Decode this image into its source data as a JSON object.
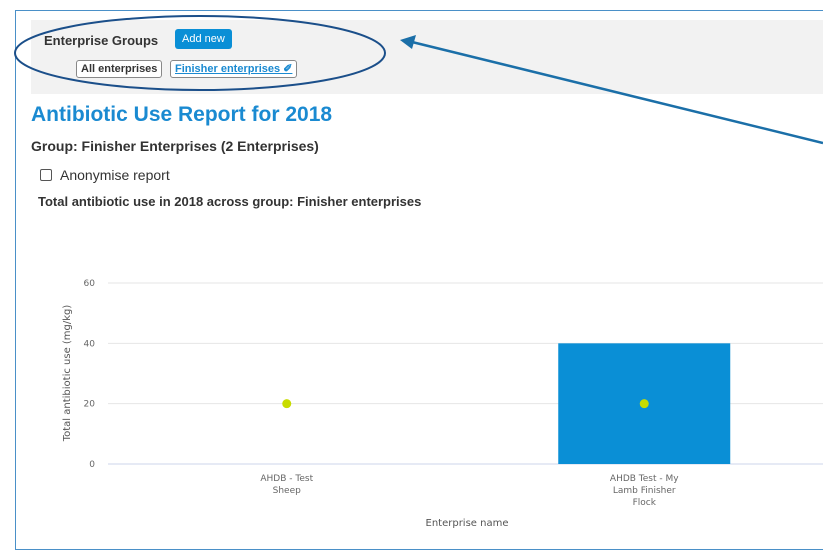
{
  "groups": {
    "title": "Enterprise Groups",
    "add_label": "Add new",
    "chips": [
      "All enterprises",
      "Finisher enterprises ✐"
    ]
  },
  "report": {
    "title": "Antibiotic Use Report for 2018",
    "group": "Group: Finisher Enterprises (2 Enterprises)",
    "anonymise_label": "Anonymise report",
    "chart_caption": "Total antibiotic use in 2018 across group: Finisher enterprises"
  },
  "colors": {
    "accent": "#1a8ad1",
    "bar": "#0a8fd6",
    "marker": "#c8dc00"
  },
  "chart_data": {
    "type": "bar",
    "categories": [
      "AHDB - Test Sheep",
      "AHDB Test - My Lamb Finisher Flock"
    ],
    "category_lines": [
      [
        "AHDB - Test",
        "Sheep"
      ],
      [
        "AHDB Test - My",
        "Lamb Finisher",
        "Flock"
      ]
    ],
    "values": [
      0,
      40
    ],
    "markers": [
      20,
      20
    ],
    "xlabel": "Enterprise name",
    "ylabel": "Total antibiotic use (mg/kg)",
    "ylim": [
      0,
      60
    ],
    "yticks": [
      "0",
      "20",
      "40",
      "60"
    ],
    "grid": true
  }
}
